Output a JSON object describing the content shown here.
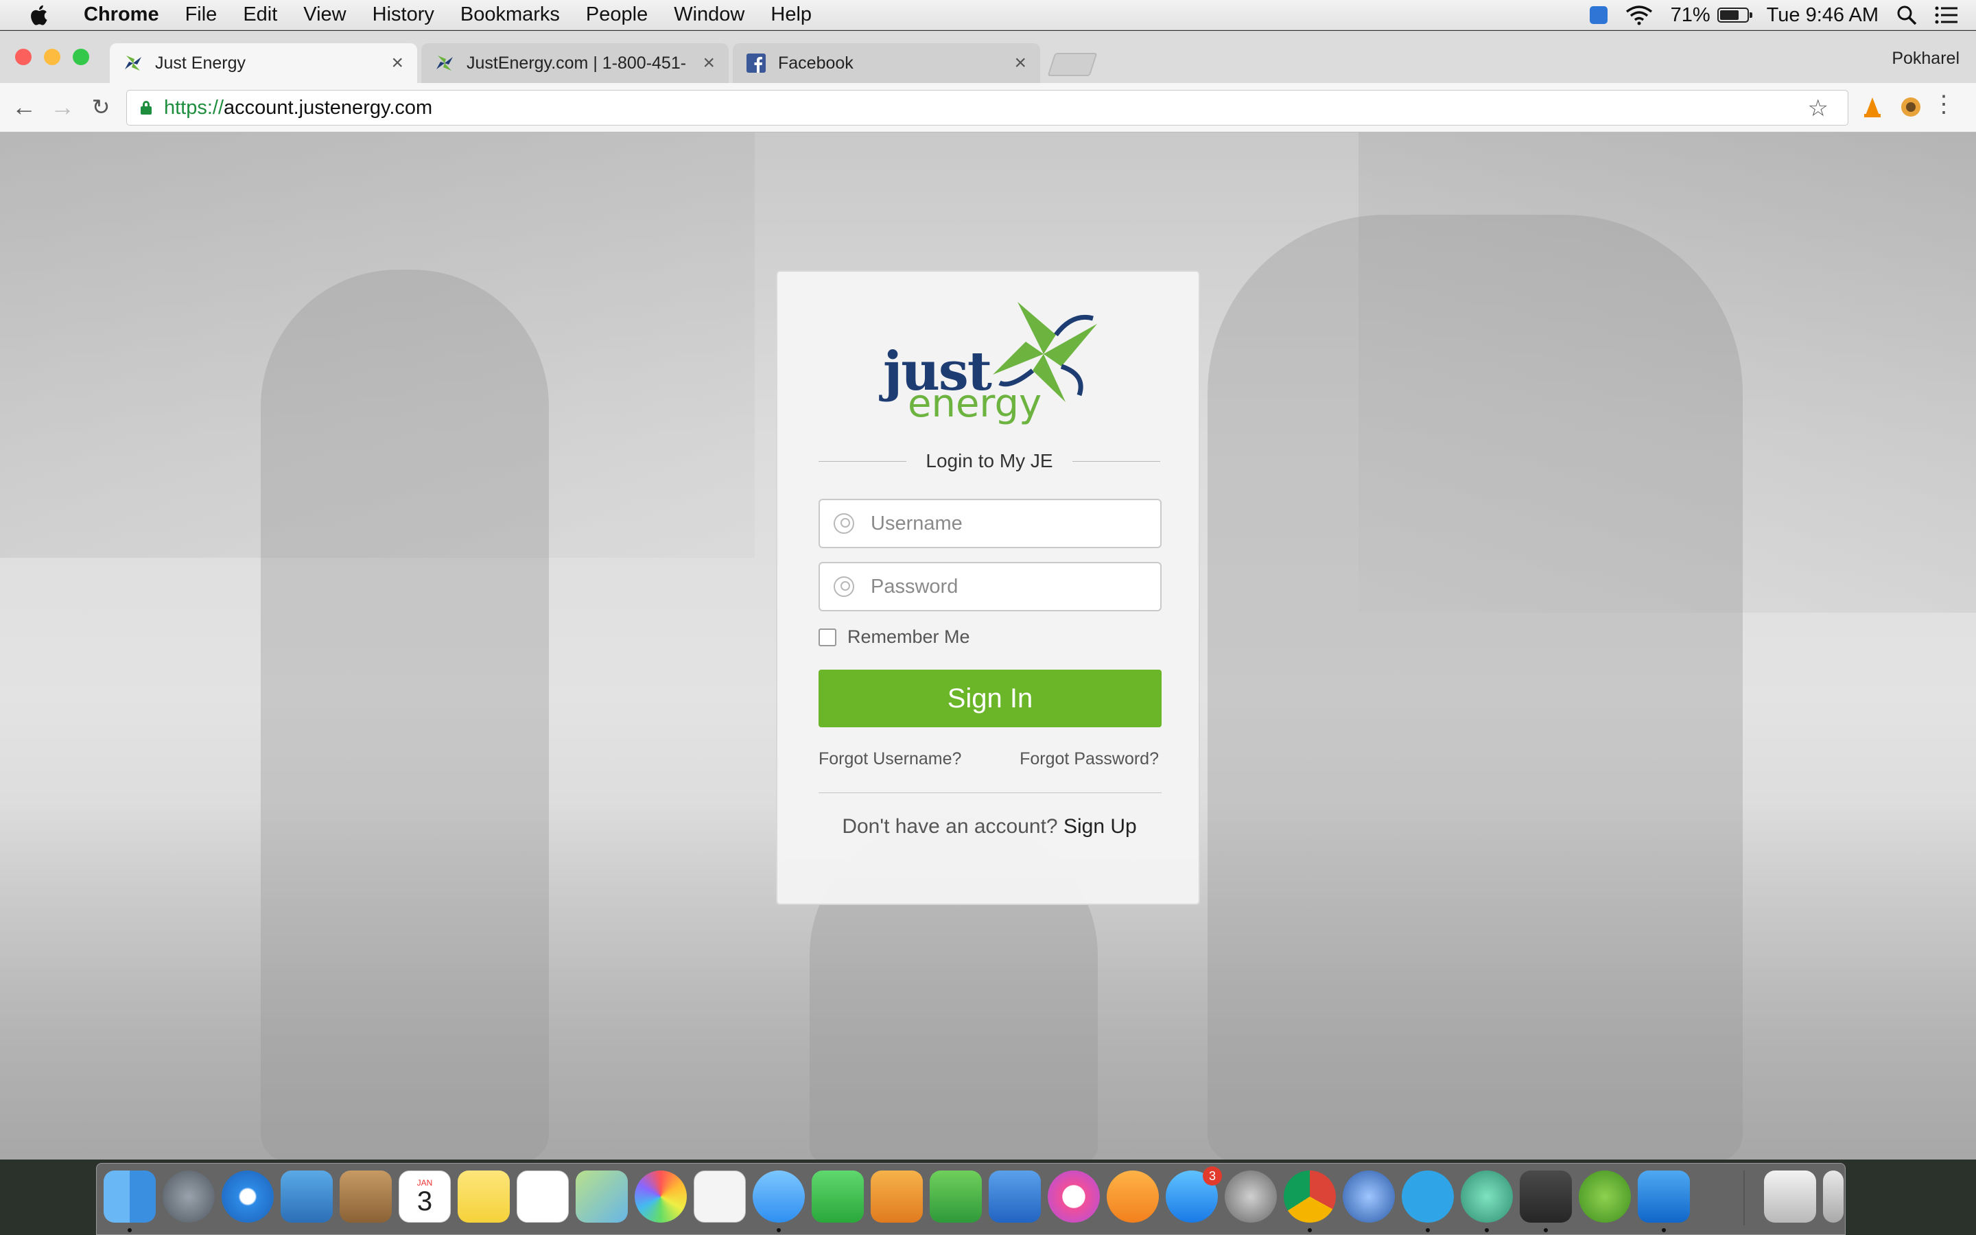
{
  "menubar": {
    "app_name": "Chrome",
    "menus": [
      "File",
      "Edit",
      "View",
      "History",
      "Bookmarks",
      "People",
      "Window",
      "Help"
    ],
    "battery_percent": "71%",
    "battery_level": 0.71,
    "clock": "Tue 9:46 AM"
  },
  "browser": {
    "tabs": [
      {
        "title": "Just Energy",
        "favicon": "pinwheel-icon",
        "active": true
      },
      {
        "title": "JustEnergy.com | 1-800-451-",
        "favicon": "pinwheel-icon",
        "active": false
      },
      {
        "title": "Facebook",
        "favicon": "facebook-icon",
        "active": false
      }
    ],
    "profile_name": "Pokharel",
    "url_scheme": "https://",
    "url_host": "account.justenergy.com"
  },
  "login": {
    "logo_word1": "just",
    "logo_word2": "energy",
    "heading": "Login to My JE",
    "username_placeholder": "Username",
    "password_placeholder": "Password",
    "remember_label": "Remember Me",
    "signin_label": "Sign In",
    "forgot_username": "Forgot Username?",
    "forgot_password": "Forgot Password?",
    "signup_prompt": "Don't have an account?",
    "signup_link": "Sign Up"
  },
  "colors": {
    "brand_green": "#6ab528",
    "brand_navy": "#1d3c72",
    "secure_green": "#1e8e3e"
  },
  "dock": {
    "items": [
      "Finder",
      "Launchpad",
      "Safari",
      "Mail",
      "Contacts",
      "Calendar",
      "Notes",
      "Reminders",
      "Maps",
      "Photos",
      "TextEdit",
      "Messages",
      "FaceTime",
      "Pages",
      "Numbers",
      "Keynote",
      "iTunes",
      "iBooks",
      "App Store",
      "System Preferences",
      "Chrome",
      "QuickTime",
      "Skype",
      "Atom",
      "Sublime Text",
      "uTorrent",
      "TeamViewer",
      "Downloads",
      "Trash"
    ],
    "calendar_month": "JAN",
    "calendar_day": "3",
    "appstore_badge": "3"
  }
}
